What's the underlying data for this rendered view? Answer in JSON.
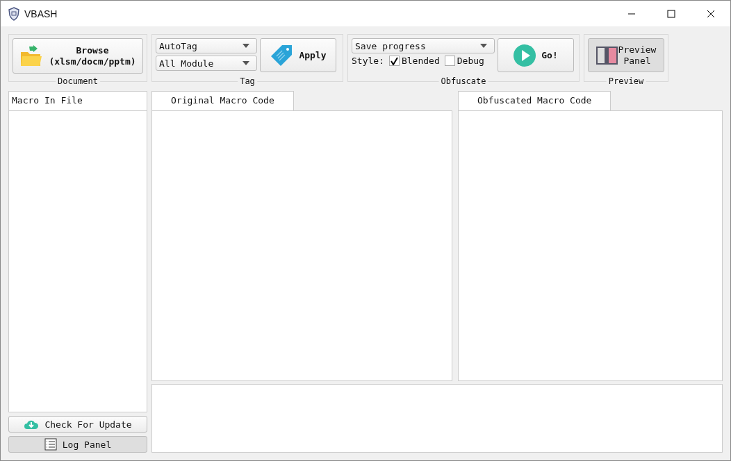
{
  "window": {
    "title": "VBASH"
  },
  "document_group": {
    "label": "Document",
    "browse_button": {
      "line1": "Browse",
      "line2": "(xlsm/docm/pptm)"
    }
  },
  "tag_group": {
    "label": "Tag",
    "dropdowns": [
      {
        "value": "AutoTag"
      },
      {
        "value": "All Module"
      }
    ],
    "apply_button": "Apply"
  },
  "obfuscate_group": {
    "label": "Obfuscate",
    "mode_dropdown": {
      "value": "Save progress"
    },
    "style_label": "Style:",
    "options": [
      {
        "label": "Blended",
        "checked": true
      },
      {
        "label": "Debug",
        "checked": false
      }
    ],
    "go_button": "Go!"
  },
  "preview_group": {
    "label": "Preview",
    "preview_button": {
      "line1": "Preview",
      "line2": "Panel",
      "pressed": true
    }
  },
  "macro_list": {
    "header": "Macro In File"
  },
  "original_tabs": [
    {
      "label": "Original Macro Code",
      "selected": true
    }
  ],
  "obfuscated_tabs": [
    {
      "label": "Obfuscated Macro Code",
      "selected": true
    }
  ],
  "side_buttons": [
    {
      "label": "Check For Update",
      "kind": "update",
      "pressed": false
    },
    {
      "label": "Log Panel",
      "kind": "log",
      "pressed": true
    }
  ]
}
